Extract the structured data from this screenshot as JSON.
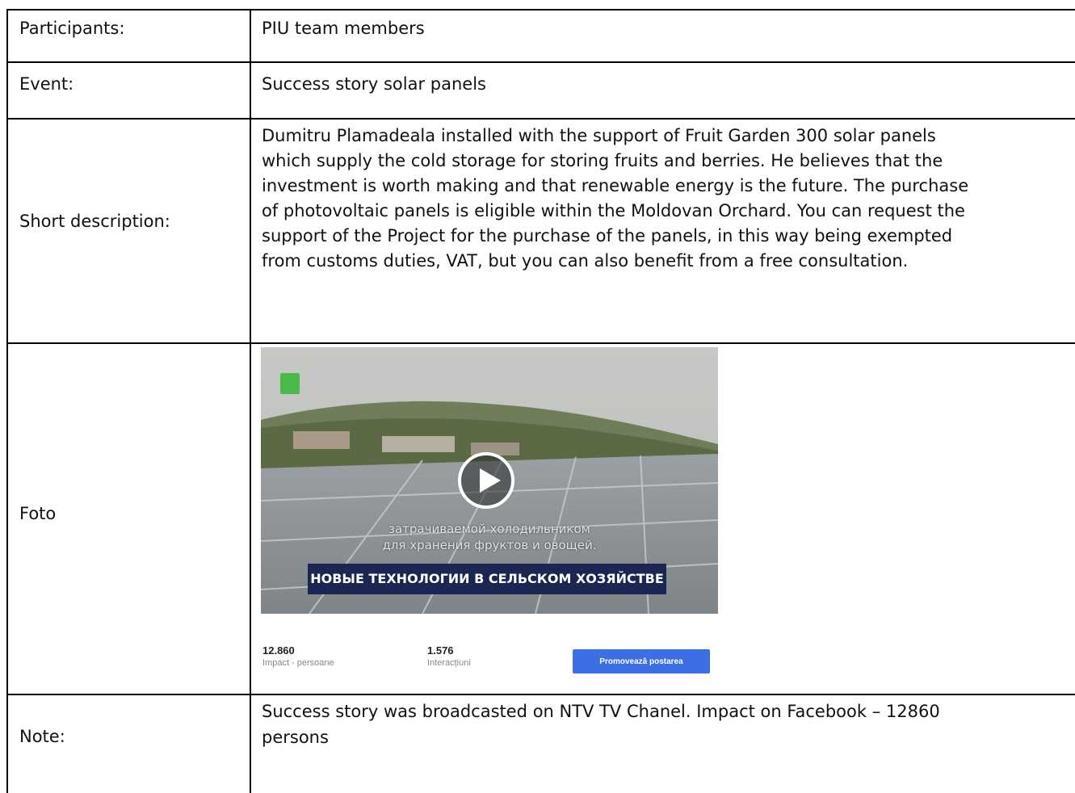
{
  "rows": [
    {
      "label": "Participants:",
      "value": "PIU team members"
    },
    {
      "label": "Event:",
      "value": "Success story solar panels"
    },
    {
      "label": "Short description:",
      "lines": [
        "Dumitru Plamadeala installed with the support of Fruit Garden 300 solar panels",
        "which supply the cold storage for storing fruits and berries. He believes that the",
        "investment is worth making and that renewable energy is the future. The purchase",
        "of photovoltaic panels is eligible within the Moldovan Orchard. You can request the",
        "support of the Project for the purchase of the panels, in this way being exempted",
        "from customs duties, VAT, but you can also benefit from a free consultation."
      ]
    },
    {
      "label": "Foto"
    },
    {
      "label": "Note:",
      "lines": [
        "Success story was broadcasted on NTV TV Chanel. Impact on Facebook – 12860",
        "persons"
      ]
    }
  ],
  "photo": {
    "subtitle_lines": [
      "затрачиваемой холодильником",
      "для хранения фруктов и овощей."
    ],
    "banner": "НОВЫЕ ТЕХНОЛОГИИ В СЕЛЬСКОМ ХОЗЯЙСТВЕ",
    "play_icon": "play-icon",
    "stats": [
      {
        "value": "12.860",
        "caption": "Impact - persoane"
      },
      {
        "value": "1.576",
        "caption": "Interacțiuni"
      }
    ],
    "promote_button": "Promovează postarea",
    "colors": {
      "banner": "#1c2652",
      "button": "#3d6fe4",
      "badge": "#4ab84a"
    }
  }
}
